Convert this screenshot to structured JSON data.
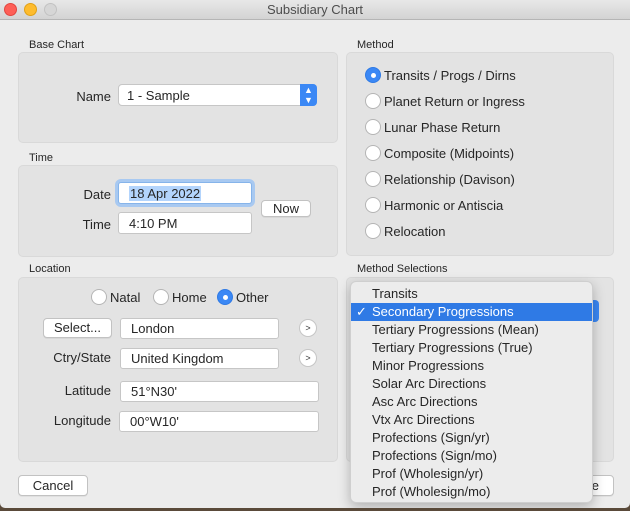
{
  "window": {
    "title": "Subsidiary Chart"
  },
  "base_chart": {
    "group_label": "Base Chart",
    "name_label": "Name",
    "name_value": "1 - Sample"
  },
  "time": {
    "group_label": "Time",
    "date_label": "Date",
    "date_value": "18 Apr 2022",
    "time_label": "Time",
    "time_value": "4:10 PM",
    "now_button": "Now"
  },
  "location": {
    "group_label": "Location",
    "options": [
      {
        "label": "Natal",
        "selected": false
      },
      {
        "label": "Home",
        "selected": false
      },
      {
        "label": "Other",
        "selected": true
      }
    ],
    "select_button": "Select...",
    "city_value": "London",
    "ctry_label": "Ctry/State",
    "ctry_value": "United Kingdom",
    "latitude_label": "Latitude",
    "latitude_value": "51°N30'",
    "longitude_label": "Longitude",
    "longitude_value": "00°W10'",
    "arrow_glyph": ">"
  },
  "method": {
    "group_label": "Method",
    "options": [
      {
        "label": "Transits / Progs / Dirns",
        "selected": true
      },
      {
        "label": "Planet Return or Ingress",
        "selected": false
      },
      {
        "label": "Lunar Phase Return",
        "selected": false
      },
      {
        "label": "Composite (Midpoints)",
        "selected": false
      },
      {
        "label": "Relationship (Davison)",
        "selected": false
      },
      {
        "label": "Harmonic or Antiscia",
        "selected": false
      },
      {
        "label": "Relocation",
        "selected": false
      }
    ]
  },
  "method_selections": {
    "group_label": "Method Selections",
    "check_glyph": "✓",
    "items": [
      {
        "label": "Transits",
        "selected": false
      },
      {
        "label": "Secondary Progressions",
        "selected": true
      },
      {
        "label": "Tertiary Progressions (Mean)",
        "selected": false
      },
      {
        "label": "Tertiary Progressions (True)",
        "selected": false
      },
      {
        "label": "Minor Progressions",
        "selected": false
      },
      {
        "label": "Solar Arc Directions",
        "selected": false
      },
      {
        "label": "Asc Arc Directions",
        "selected": false
      },
      {
        "label": "Vtx Arc Directions",
        "selected": false
      },
      {
        "label": "Profections (Sign/yr)",
        "selected": false
      },
      {
        "label": "Profections (Sign/mo)",
        "selected": false
      },
      {
        "label": "Prof (Wholesign/yr)",
        "selected": false
      },
      {
        "label": "Prof (Wholesign/mo)",
        "selected": false
      }
    ]
  },
  "footer": {
    "cancel_button": "Cancel",
    "ok_button_partial": "e"
  },
  "colors": {
    "accent": "#3b88f5",
    "menu_highlight": "#2f7ae5",
    "close": "#fe5f57",
    "minimize": "#febc2e"
  }
}
